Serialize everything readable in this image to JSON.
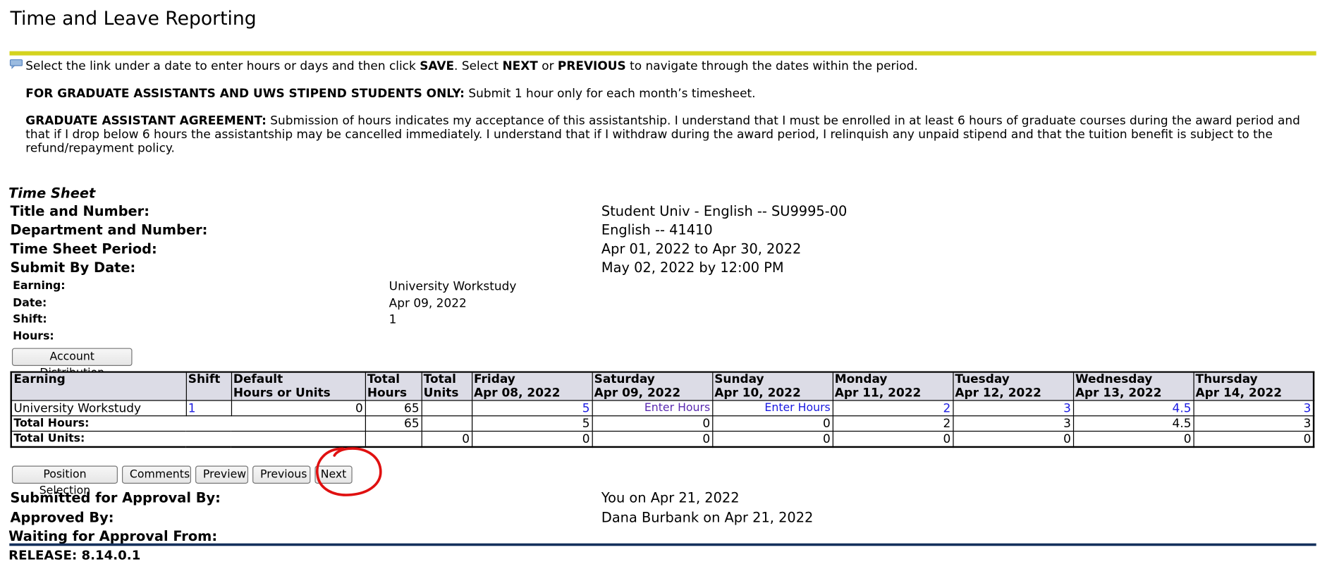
{
  "page": {
    "title": "Time and Leave Reporting",
    "accent_color": "#d4d31f",
    "footer_rule_color": "#14305c"
  },
  "info": {
    "line1_prefix": "Select the link under a date to enter hours or days and then click ",
    "line1_save": "SAVE",
    "line1_mid": ". Select ",
    "line1_next": "NEXT",
    "line1_or": " or ",
    "line1_previous": "PREVIOUS",
    "line1_suffix": " to navigate through the dates within the period.",
    "grad_label": "FOR GRADUATE ASSISTANTS AND UWS STIPEND STUDENTS ONLY:",
    "grad_text": " Submit 1 hour only for each month’s timesheet.",
    "agreement_label": "GRADUATE ASSISTANT AGREEMENT:",
    "agreement_text": " Submission of hours indicates my acceptance of this assistantship. I understand that I must be enrolled in at least 6 hours of graduate courses during the award period and that if I drop below 6 hours the assistantship may be cancelled immediately. I understand that if I withdraw during the award period, I relinquish any unpaid stipend and that the tuition benefit is subject to the refund/repayment policy.",
    "icon": "info-speech-bubble-icon"
  },
  "timesheet": {
    "section_title": "Time Sheet",
    "title_label": "Title and Number:",
    "title_value": "Student Univ - English -- SU9995-00",
    "dept_label": "Department and Number:",
    "dept_value": "English -- 41410",
    "period_label": "Time Sheet Period:",
    "period_value": "Apr 01, 2022 to Apr 30, 2022",
    "submit_label": "Submit By Date:",
    "submit_value": "May 02, 2022 by 12:00 PM",
    "earning_label": "Earning:",
    "earning_value": "University Workstudy",
    "date_label": "Date:",
    "date_value": "Apr 09, 2022",
    "shift_label": "Shift:",
    "shift_value": "1",
    "hours_label": "Hours:",
    "hours_value": ""
  },
  "buttons": {
    "account_distribution": "Account Distribution",
    "position_selection": "Position Selection",
    "comments": "Comments",
    "preview": "Preview",
    "previous": "Previous",
    "next": "Next"
  },
  "table": {
    "headers": {
      "earning": "Earning",
      "shift": "Shift",
      "default_1": "Default",
      "default_2": "Hours or Units",
      "total_hours_1": "Total",
      "total_hours_2": "Hours",
      "total_units_1": "Total",
      "total_units_2": "Units",
      "days": [
        {
          "day": "Friday",
          "date": "Apr 08, 2022"
        },
        {
          "day": "Saturday",
          "date": "Apr 09, 2022"
        },
        {
          "day": "Sunday",
          "date": "Apr 10, 2022"
        },
        {
          "day": "Monday",
          "date": "Apr 11, 2022"
        },
        {
          "day": "Tuesday",
          "date": "Apr 12, 2022"
        },
        {
          "day": "Wednesday",
          "date": "Apr 13, 2022"
        },
        {
          "day": "Thursday",
          "date": "Apr 14, 2022"
        }
      ]
    },
    "row": {
      "earning": "University Workstudy",
      "shift": "1",
      "default": "0",
      "total_hours": "65",
      "total_units": "",
      "days": [
        "5",
        "Enter Hours",
        "Enter Hours",
        "2",
        "3",
        "4.5",
        "3"
      ]
    },
    "total_hours_row": {
      "label": "Total Hours:",
      "total": "65",
      "days": [
        "5",
        "0",
        "0",
        "2",
        "3",
        "4.5",
        "3"
      ]
    },
    "total_units_row": {
      "label": "Total Units:",
      "total": "0",
      "days": [
        "0",
        "0",
        "0",
        "0",
        "0",
        "0",
        "0"
      ]
    }
  },
  "approval": {
    "submitted_label": "Submitted for Approval By:",
    "submitted_value": "You on Apr 21, 2022",
    "approved_label": "Approved By:",
    "approved_value": "Dana Burbank on Apr 21, 2022",
    "waiting_label": "Waiting for Approval From:",
    "waiting_value": ""
  },
  "annotation": {
    "color": "#e01010",
    "target": "Next"
  },
  "footer": {
    "release": "RELEASE: 8.14.0.1"
  }
}
